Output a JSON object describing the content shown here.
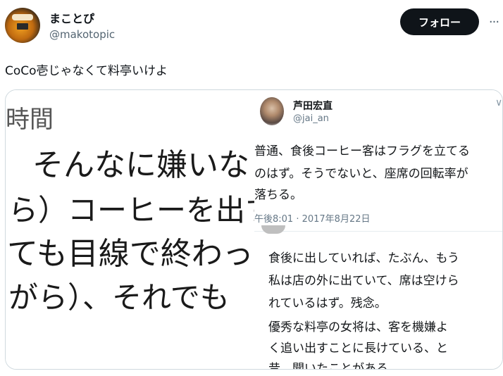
{
  "author": {
    "display_name": "まことぴ",
    "handle": "@makotopic"
  },
  "actions": {
    "follow_label": "フォロー",
    "more_label": "···"
  },
  "tweet": {
    "text": "CoCo壱じゃなくて料亭いけよ"
  },
  "media": {
    "left_image": {
      "lines": [
        "時間",
        "そんなに嫌いな",
        "ら）コーヒーを出す",
        "ても目線で終わった",
        "がら）、それでも"
      ]
    },
    "right_image": {
      "name": "芦田宏直",
      "handle": "@jai_an",
      "chevron": "∨",
      "body_lines": [
        "普通、食後コーヒー客はフラグを立てる",
        "のはず。そうでないと、座席の回転率が",
        "落ちる。"
      ],
      "meta": "午後8:01 · 2017年8月22日",
      "reply_lines": [
        "食後に出していれば、たぶん、もう",
        "私は店の外に出ていて、席は空けら",
        "れているはず。残念。",
        "優秀な料亭の女将は、客を機嫌よ",
        "く追い出すことに長けている、と",
        "昔、聞いたことがある。"
      ]
    }
  }
}
